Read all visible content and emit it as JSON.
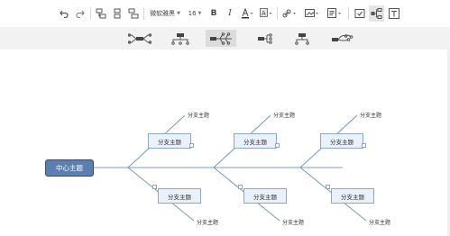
{
  "toolbar": {
    "font_name": "微软雅黑",
    "font_size": "16",
    "icons": [
      "undo-icon",
      "redo-icon",
      "insert-topic-icon",
      "insert-subtopic-icon",
      "insert-parent-icon",
      "bold-icon",
      "italic-icon",
      "font-color-icon",
      "highlight-icon",
      "link-icon",
      "image-icon",
      "note-icon",
      "task-icon",
      "structure-icon",
      "text-icon"
    ]
  },
  "layouts": {
    "items": [
      "mindmap-layout",
      "org-chart-layout",
      "fishbone-layout",
      "logic-layout",
      "tree-layout",
      "free-layout"
    ],
    "active_index": 2
  },
  "mindmap": {
    "center": "中心主题",
    "branches": [
      {
        "label": "分支主题",
        "leaf": "分支主题"
      },
      {
        "label": "分支主题",
        "leaf": "分支主题"
      },
      {
        "label": "分支主题",
        "leaf": "分支主题"
      },
      {
        "label": "分支主题",
        "leaf": "分支主题"
      },
      {
        "label": "分支主题",
        "leaf": "分支主题"
      },
      {
        "label": "分支主题",
        "leaf": "分支主题"
      }
    ]
  },
  "colors": {
    "center_fill": "#5b7fae",
    "branch_fill": "#e9f1fa",
    "line": "#7f9db9"
  }
}
